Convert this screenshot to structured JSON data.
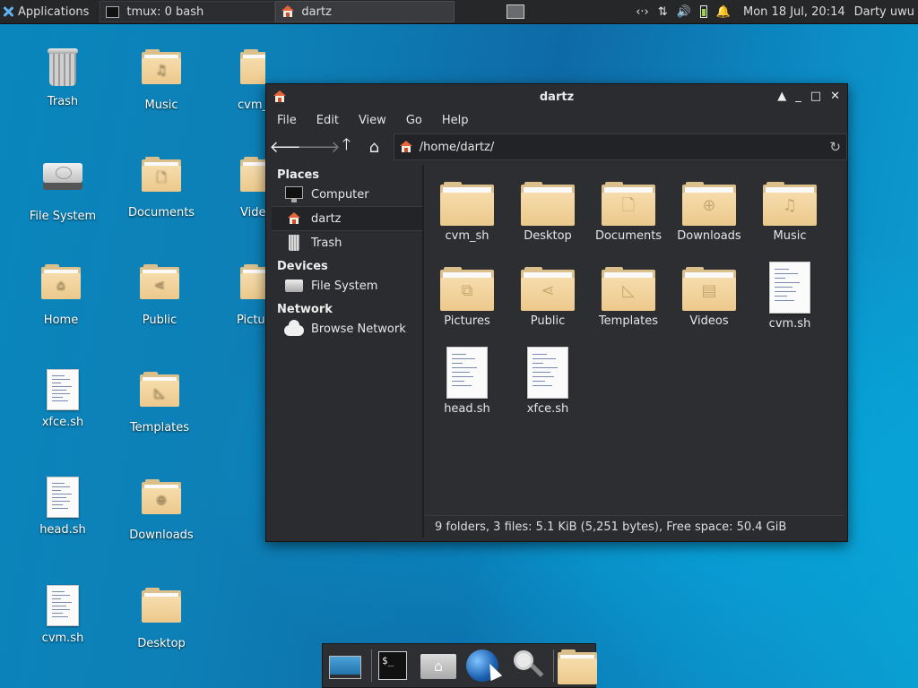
{
  "panel": {
    "applications_label": "Applications",
    "tasks": [
      {
        "label": "tmux: 0 bash"
      },
      {
        "label": "dartz"
      }
    ],
    "clock": "Mon 18 Jul, 20:14",
    "user": "Darty uwu",
    "tray": {
      "network_glyph": "‹·›",
      "updown_glyph": "⇅",
      "volume_glyph": "🔊",
      "bell_glyph": "🔔"
    }
  },
  "desktop": {
    "icons": [
      {
        "label": "Trash"
      },
      {
        "label": "Music"
      },
      {
        "label": "cvm_sh"
      },
      {
        "label": "File System"
      },
      {
        "label": "Documents"
      },
      {
        "label": "Videos"
      },
      {
        "label": "Home"
      },
      {
        "label": "Public"
      },
      {
        "label": "Pictures"
      },
      {
        "label": "xfce.sh"
      },
      {
        "label": "Templates"
      },
      {
        "label": "head.sh"
      },
      {
        "label": "Downloads"
      },
      {
        "label": "cvm.sh"
      },
      {
        "label": "Desktop"
      }
    ]
  },
  "window": {
    "title": "dartz",
    "controls": {
      "up": "▲",
      "minimize": "_",
      "maximize": "□",
      "close": "✕"
    },
    "menu": [
      "File",
      "Edit",
      "View",
      "Go",
      "Help"
    ],
    "toolbar": {
      "back": "🡐",
      "forward": "🡒",
      "up": "🡑",
      "home": "⌂"
    },
    "address": "/home/dartz/",
    "reload_glyph": "↻",
    "sidebar": {
      "places_heading": "Places",
      "places": [
        {
          "label": "Computer"
        },
        {
          "label": "dartz"
        },
        {
          "label": "Trash"
        }
      ],
      "devices_heading": "Devices",
      "devices": [
        {
          "label": "File System"
        }
      ],
      "network_heading": "Network",
      "network": [
        {
          "label": "Browse Network"
        }
      ]
    },
    "files": [
      {
        "label": "cvm_sh",
        "kind": "folder",
        "emblem": ""
      },
      {
        "label": "Desktop",
        "kind": "folder",
        "emblem": ""
      },
      {
        "label": "Documents",
        "kind": "folder",
        "emblem": "🗋"
      },
      {
        "label": "Downloads",
        "kind": "folder",
        "emblem": "⊕"
      },
      {
        "label": "Music",
        "kind": "folder",
        "emblem": "♫"
      },
      {
        "label": "Pictures",
        "kind": "folder",
        "emblem": "⧉"
      },
      {
        "label": "Public",
        "kind": "folder",
        "emblem": "⋖"
      },
      {
        "label": "Templates",
        "kind": "folder",
        "emblem": "◺"
      },
      {
        "label": "Videos",
        "kind": "folder",
        "emblem": "▤"
      },
      {
        "label": "cvm.sh",
        "kind": "script"
      },
      {
        "label": "head.sh",
        "kind": "script"
      },
      {
        "label": "xfce.sh",
        "kind": "script"
      }
    ],
    "status": "9 folders, 3 files: 5.1 KiB (5,251 bytes), Free space: 50.4 GiB"
  },
  "dock": {
    "terminal_prompt": "$_"
  }
}
